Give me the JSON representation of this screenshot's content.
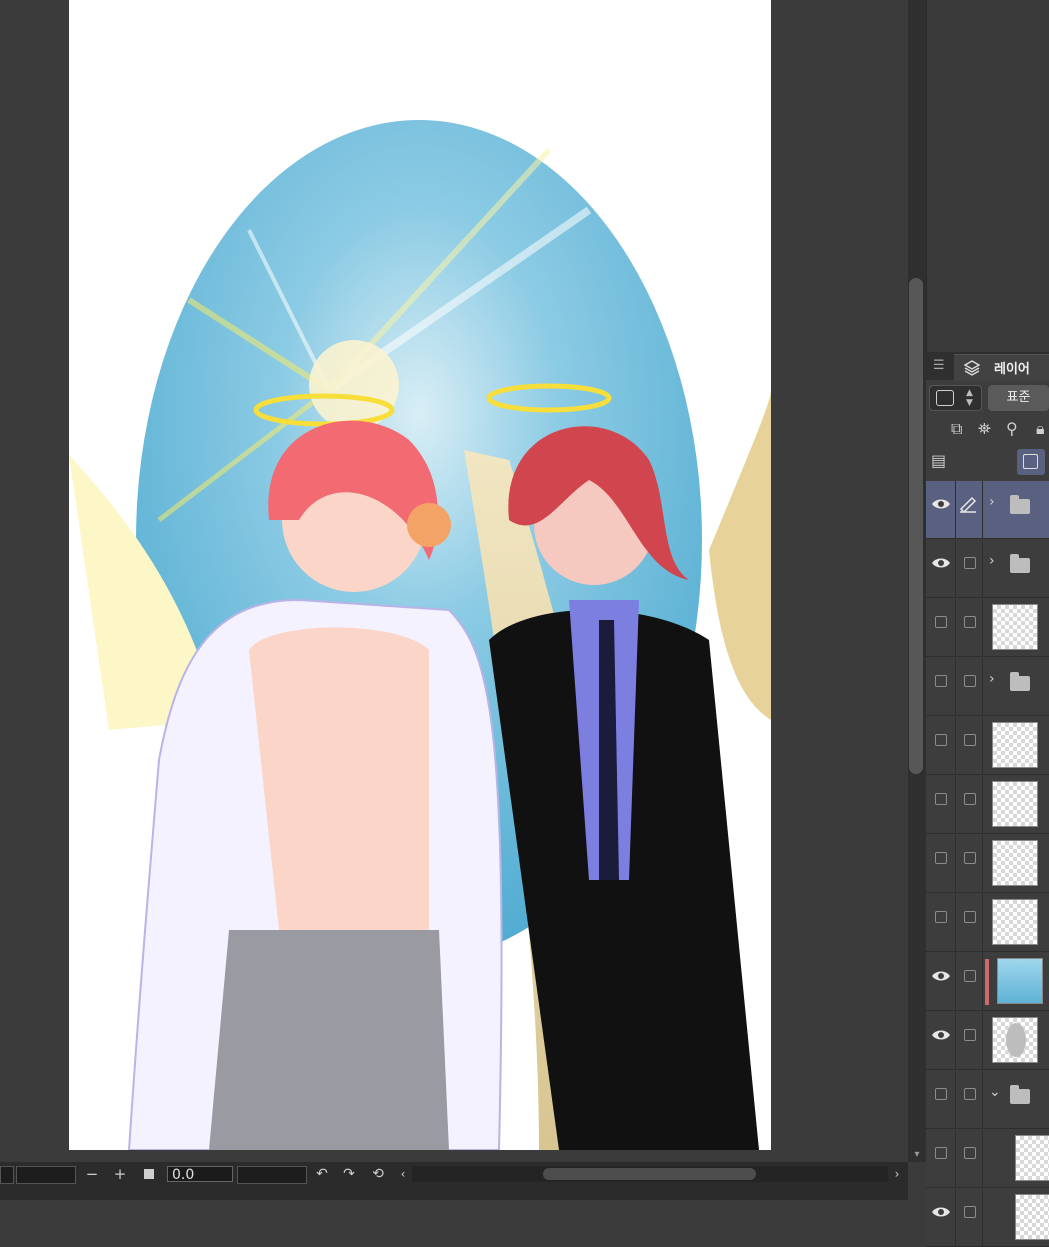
{
  "layer_panel": {
    "tab_label": "레이어",
    "blend_mode": "표준",
    "layers": [
      {
        "kind": "folder",
        "visible": true,
        "selected": true,
        "expanded": false
      },
      {
        "kind": "folder",
        "visible": true,
        "selected": false,
        "expanded": false
      },
      {
        "kind": "sketch",
        "visible": false,
        "selected": false
      },
      {
        "kind": "folder",
        "visible": false,
        "selected": false,
        "expanded": false
      },
      {
        "kind": "sketch",
        "visible": false,
        "selected": false
      },
      {
        "kind": "sketch",
        "visible": false,
        "selected": false
      },
      {
        "kind": "sketch",
        "visible": false,
        "selected": false
      },
      {
        "kind": "sketch",
        "visible": false,
        "selected": false
      },
      {
        "kind": "background-image",
        "visible": true,
        "selected": false
      },
      {
        "kind": "mask",
        "visible": true,
        "selected": false
      },
      {
        "kind": "folder",
        "visible": false,
        "selected": false,
        "expanded": true
      },
      {
        "kind": "sketch",
        "visible": false,
        "selected": false
      },
      {
        "kind": "sketch",
        "visible": true,
        "selected": false
      }
    ]
  },
  "bottom_bar": {
    "rotation_value": "0.0",
    "zoom_out_label": "−",
    "zoom_in_label": "+"
  },
  "colors": {
    "selected_row": "#5a6080",
    "accent_red": "#d06a6a",
    "sky": "#5fb3d6"
  },
  "icons": [
    "menu-icon",
    "layers-icon",
    "eye-icon",
    "pen-icon",
    "folder-icon",
    "chevron-right-icon",
    "chevron-down-icon",
    "undo-icon",
    "redo-icon",
    "reset-rotation-icon",
    "chevron-left-icon"
  ]
}
